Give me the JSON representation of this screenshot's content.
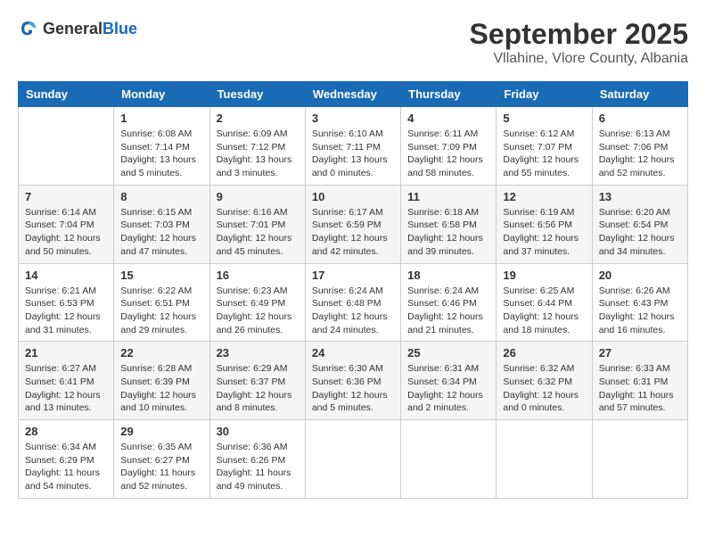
{
  "header": {
    "logo": {
      "general": "General",
      "blue": "Blue"
    },
    "month": "September 2025",
    "location": "Vllahine, Vlore County, Albania"
  },
  "days_of_week": [
    "Sunday",
    "Monday",
    "Tuesday",
    "Wednesday",
    "Thursday",
    "Friday",
    "Saturday"
  ],
  "weeks": [
    [
      {
        "day": "",
        "info": ""
      },
      {
        "day": "1",
        "info": "Sunrise: 6:08 AM\nSunset: 7:14 PM\nDaylight: 13 hours\nand 5 minutes."
      },
      {
        "day": "2",
        "info": "Sunrise: 6:09 AM\nSunset: 7:12 PM\nDaylight: 13 hours\nand 3 minutes."
      },
      {
        "day": "3",
        "info": "Sunrise: 6:10 AM\nSunset: 7:11 PM\nDaylight: 13 hours\nand 0 minutes."
      },
      {
        "day": "4",
        "info": "Sunrise: 6:11 AM\nSunset: 7:09 PM\nDaylight: 12 hours\nand 58 minutes."
      },
      {
        "day": "5",
        "info": "Sunrise: 6:12 AM\nSunset: 7:07 PM\nDaylight: 12 hours\nand 55 minutes."
      },
      {
        "day": "6",
        "info": "Sunrise: 6:13 AM\nSunset: 7:06 PM\nDaylight: 12 hours\nand 52 minutes."
      }
    ],
    [
      {
        "day": "7",
        "info": "Sunrise: 6:14 AM\nSunset: 7:04 PM\nDaylight: 12 hours\nand 50 minutes."
      },
      {
        "day": "8",
        "info": "Sunrise: 6:15 AM\nSunset: 7:03 PM\nDaylight: 12 hours\nand 47 minutes."
      },
      {
        "day": "9",
        "info": "Sunrise: 6:16 AM\nSunset: 7:01 PM\nDaylight: 12 hours\nand 45 minutes."
      },
      {
        "day": "10",
        "info": "Sunrise: 6:17 AM\nSunset: 6:59 PM\nDaylight: 12 hours\nand 42 minutes."
      },
      {
        "day": "11",
        "info": "Sunrise: 6:18 AM\nSunset: 6:58 PM\nDaylight: 12 hours\nand 39 minutes."
      },
      {
        "day": "12",
        "info": "Sunrise: 6:19 AM\nSunset: 6:56 PM\nDaylight: 12 hours\nand 37 minutes."
      },
      {
        "day": "13",
        "info": "Sunrise: 6:20 AM\nSunset: 6:54 PM\nDaylight: 12 hours\nand 34 minutes."
      }
    ],
    [
      {
        "day": "14",
        "info": "Sunrise: 6:21 AM\nSunset: 6:53 PM\nDaylight: 12 hours\nand 31 minutes."
      },
      {
        "day": "15",
        "info": "Sunrise: 6:22 AM\nSunset: 6:51 PM\nDaylight: 12 hours\nand 29 minutes."
      },
      {
        "day": "16",
        "info": "Sunrise: 6:23 AM\nSunset: 6:49 PM\nDaylight: 12 hours\nand 26 minutes."
      },
      {
        "day": "17",
        "info": "Sunrise: 6:24 AM\nSunset: 6:48 PM\nDaylight: 12 hours\nand 24 minutes."
      },
      {
        "day": "18",
        "info": "Sunrise: 6:24 AM\nSunset: 6:46 PM\nDaylight: 12 hours\nand 21 minutes."
      },
      {
        "day": "19",
        "info": "Sunrise: 6:25 AM\nSunset: 6:44 PM\nDaylight: 12 hours\nand 18 minutes."
      },
      {
        "day": "20",
        "info": "Sunrise: 6:26 AM\nSunset: 6:43 PM\nDaylight: 12 hours\nand 16 minutes."
      }
    ],
    [
      {
        "day": "21",
        "info": "Sunrise: 6:27 AM\nSunset: 6:41 PM\nDaylight: 12 hours\nand 13 minutes."
      },
      {
        "day": "22",
        "info": "Sunrise: 6:28 AM\nSunset: 6:39 PM\nDaylight: 12 hours\nand 10 minutes."
      },
      {
        "day": "23",
        "info": "Sunrise: 6:29 AM\nSunset: 6:37 PM\nDaylight: 12 hours\nand 8 minutes."
      },
      {
        "day": "24",
        "info": "Sunrise: 6:30 AM\nSunset: 6:36 PM\nDaylight: 12 hours\nand 5 minutes."
      },
      {
        "day": "25",
        "info": "Sunrise: 6:31 AM\nSunset: 6:34 PM\nDaylight: 12 hours\nand 2 minutes."
      },
      {
        "day": "26",
        "info": "Sunrise: 6:32 AM\nSunset: 6:32 PM\nDaylight: 12 hours\nand 0 minutes."
      },
      {
        "day": "27",
        "info": "Sunrise: 6:33 AM\nSunset: 6:31 PM\nDaylight: 11 hours\nand 57 minutes."
      }
    ],
    [
      {
        "day": "28",
        "info": "Sunrise: 6:34 AM\nSunset: 6:29 PM\nDaylight: 11 hours\nand 54 minutes."
      },
      {
        "day": "29",
        "info": "Sunrise: 6:35 AM\nSunset: 6:27 PM\nDaylight: 11 hours\nand 52 minutes."
      },
      {
        "day": "30",
        "info": "Sunrise: 6:36 AM\nSunset: 6:26 PM\nDaylight: 11 hours\nand 49 minutes."
      },
      {
        "day": "",
        "info": ""
      },
      {
        "day": "",
        "info": ""
      },
      {
        "day": "",
        "info": ""
      },
      {
        "day": "",
        "info": ""
      }
    ]
  ]
}
